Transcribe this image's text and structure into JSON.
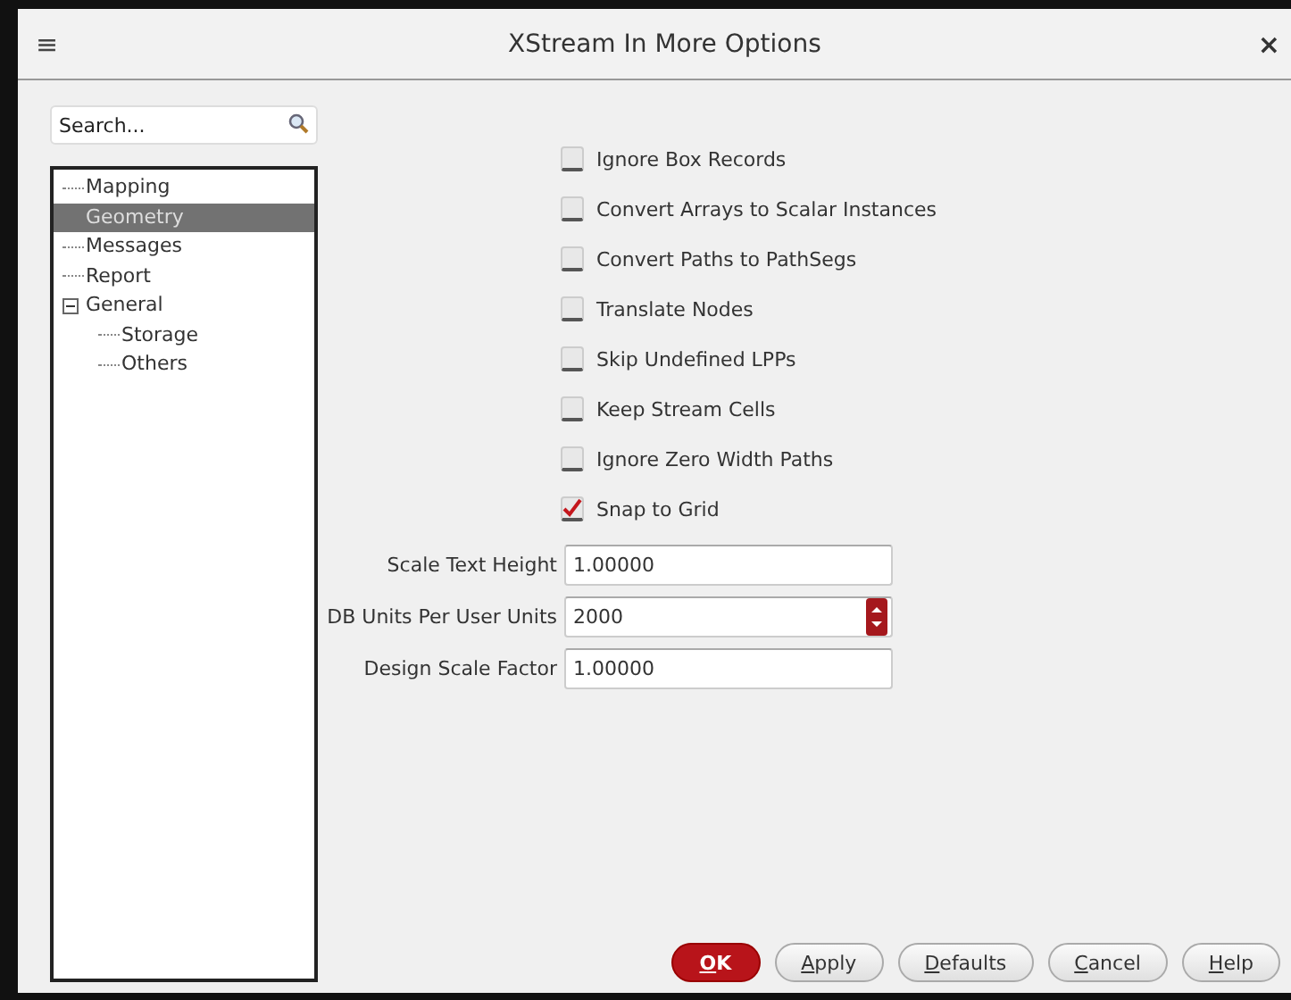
{
  "window": {
    "title": "XStream In More Options",
    "menu_icon": "≡",
    "close_icon": "×"
  },
  "sidebar": {
    "search": {
      "placeholder": "Search..."
    },
    "tree": [
      {
        "label": "Mapping",
        "selected": false
      },
      {
        "label": "Geometry",
        "selected": true
      },
      {
        "label": "Messages",
        "selected": false
      },
      {
        "label": "Report",
        "selected": false
      },
      {
        "label": "General",
        "selected": false,
        "expanded": true,
        "children": [
          {
            "label": "Storage",
            "selected": false
          },
          {
            "label": "Others",
            "selected": false
          }
        ]
      }
    ]
  },
  "options": [
    {
      "label": "Ignore Box Records",
      "checked": false
    },
    {
      "label": "Convert Arrays to Scalar Instances",
      "checked": false
    },
    {
      "label": "Convert Paths to PathSegs",
      "checked": false
    },
    {
      "label": "Translate Nodes",
      "checked": false
    },
    {
      "label": "Skip Undefined LPPs",
      "checked": false
    },
    {
      "label": "Keep Stream Cells",
      "checked": false
    },
    {
      "label": "Ignore Zero Width Paths",
      "checked": false
    },
    {
      "label": "Snap to Grid",
      "checked": true
    }
  ],
  "fields": [
    {
      "label": "Scale Text Height",
      "value": "1.00000",
      "kind": "text"
    },
    {
      "label": "DB Units Per User Units",
      "value": "2000",
      "kind": "spin"
    },
    {
      "label": "Design Scale Factor",
      "value": "1.00000",
      "kind": "text"
    }
  ],
  "buttons": [
    {
      "mnemonic": "O",
      "rest": "K",
      "kind": "primary"
    },
    {
      "mnemonic": "A",
      "rest": "pply",
      "kind": "normal"
    },
    {
      "mnemonic": "D",
      "rest": "efaults",
      "kind": "normal"
    },
    {
      "mnemonic": "C",
      "rest": "ancel",
      "kind": "normal"
    },
    {
      "mnemonic": "H",
      "rest": "elp",
      "kind": "normal"
    }
  ]
}
